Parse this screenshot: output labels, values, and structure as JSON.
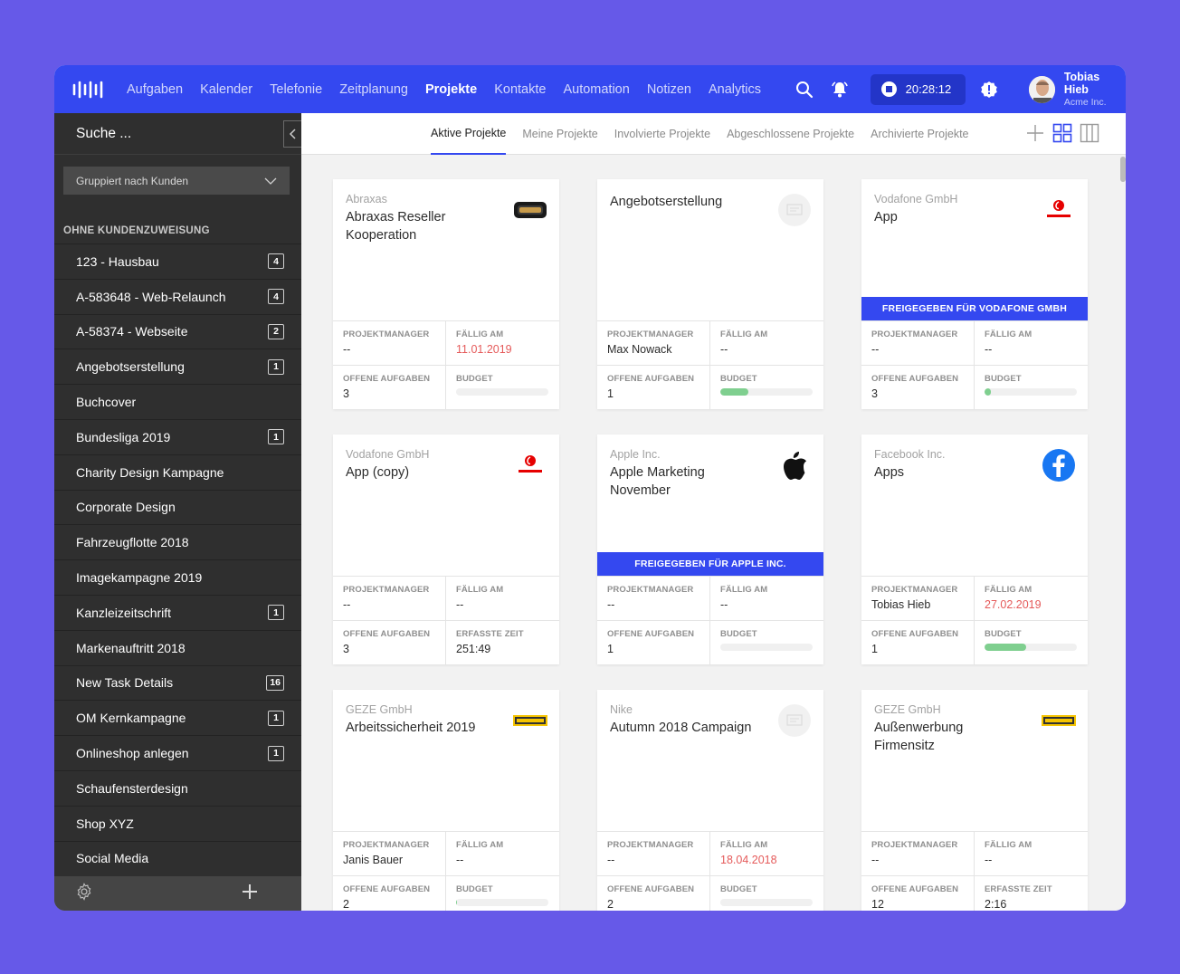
{
  "nav": {
    "items": [
      "Aufgaben",
      "Kalender",
      "Telefonie",
      "Zeitplanung",
      "Projekte",
      "Kontakte",
      "Automation",
      "Notizen",
      "Analytics"
    ],
    "active_index": 4
  },
  "timer": {
    "time": "20:28:12"
  },
  "user": {
    "name": "Tobias Hieb",
    "org": "Acme Inc."
  },
  "sidebar": {
    "search_placeholder": "Suche ...",
    "group_label": "Gruppiert nach Kunden",
    "section_title": "OHNE KUNDENZUWEISUNG",
    "items": [
      {
        "label": "123 - Hausbau",
        "count": "4"
      },
      {
        "label": "A-583648 - Web-Relaunch",
        "count": "4"
      },
      {
        "label": "A-58374 - Webseite",
        "count": "2"
      },
      {
        "label": "Angebotserstellung",
        "count": "1"
      },
      {
        "label": "Buchcover",
        "count": ""
      },
      {
        "label": "Bundesliga 2019",
        "count": "1"
      },
      {
        "label": "Charity Design Kampagne",
        "count": ""
      },
      {
        "label": "Corporate Design",
        "count": ""
      },
      {
        "label": "Fahrzeugflotte 2018",
        "count": ""
      },
      {
        "label": "Imagekampagne 2019",
        "count": ""
      },
      {
        "label": "Kanzleizeitschrift",
        "count": "1"
      },
      {
        "label": "Markenauftritt 2018",
        "count": ""
      },
      {
        "label": "New Task Details",
        "count": "16"
      },
      {
        "label": "OM Kernkampagne",
        "count": "1"
      },
      {
        "label": "Onlineshop anlegen",
        "count": "1"
      },
      {
        "label": "Schaufensterdesign",
        "count": ""
      },
      {
        "label": "Shop XYZ",
        "count": ""
      },
      {
        "label": "Social Media",
        "count": ""
      }
    ]
  },
  "tabs": [
    "Aktive Projekte",
    "Meine Projekte",
    "Involvierte Projekte",
    "Abgeschlossene Projekte",
    "Archivierte Projekte"
  ],
  "labels": {
    "manager": "PROJEKTMANAGER",
    "due": "FÄLLIG AM",
    "open_tasks": "OFFENE AUFGABEN",
    "budget": "BUDGET",
    "tracked": "ERFASSTE ZEIT"
  },
  "colors": {
    "brand": "#3448F0",
    "overdue": "#e55a5a",
    "budget": "#7fcf8f"
  },
  "cards": [
    {
      "client": "Abraxas",
      "name": "Abraxas Reseller Kooperation",
      "logo": "abraxas-logo-icon",
      "shared": "",
      "manager": "--",
      "due": "11.01.2019",
      "due_overdue": true,
      "tasks": "3",
      "metric": "budget",
      "budget_fraction": 0,
      "tracked": ""
    },
    {
      "client": "",
      "name": "Angebotserstellung",
      "logo": "placeholder-logo-icon",
      "shared": "",
      "manager": "Max Nowack",
      "due": "--",
      "due_overdue": false,
      "tasks": "1",
      "metric": "budget",
      "budget_fraction": 0.3,
      "tracked": ""
    },
    {
      "client": "Vodafone GmbH",
      "name": "App",
      "logo": "vodafone-logo-icon",
      "shared": "FREIGEGEBEN FÜR VODAFONE GMBH",
      "manager": "--",
      "due": "--",
      "due_overdue": false,
      "tasks": "3",
      "metric": "budget",
      "budget_fraction": 0.07,
      "tracked": ""
    },
    {
      "client": "Vodafone GmbH",
      "name": "App (copy)",
      "logo": "vodafone-logo-icon",
      "shared": "",
      "manager": "--",
      "due": "--",
      "due_overdue": false,
      "tasks": "3",
      "metric": "tracked",
      "budget_fraction": 0,
      "tracked": "251:49"
    },
    {
      "client": "Apple Inc.",
      "name": "Apple Marketing November",
      "logo": "apple-logo-icon",
      "shared": "FREIGEGEBEN FÜR APPLE INC.",
      "manager": "--",
      "due": "--",
      "due_overdue": false,
      "tasks": "1",
      "metric": "budget",
      "budget_fraction": 0,
      "tracked": ""
    },
    {
      "client": "Facebook Inc.",
      "name": "Apps",
      "logo": "facebook-logo-icon",
      "shared": "",
      "manager": "Tobias Hieb",
      "due": "27.02.2019",
      "due_overdue": true,
      "tasks": "1",
      "metric": "budget",
      "budget_fraction": 0.45,
      "tracked": ""
    },
    {
      "client": "GEZE GmbH",
      "name": "Arbeitssicherheit 2019",
      "logo": "geze-logo-icon",
      "shared": "",
      "manager": "Janis Bauer",
      "due": "--",
      "due_overdue": false,
      "tasks": "2",
      "metric": "budget",
      "budget_fraction": 0.01,
      "tracked": ""
    },
    {
      "client": "Nike",
      "name": "Autumn 2018 Campaign",
      "logo": "placeholder-logo-icon",
      "shared": "",
      "manager": "--",
      "due": "18.04.2018",
      "due_overdue": true,
      "tasks": "2",
      "metric": "budget",
      "budget_fraction": 0,
      "tracked": ""
    },
    {
      "client": "GEZE GmbH",
      "name": "Außenwerbung Firmensitz",
      "logo": "geze-logo-icon",
      "shared": "",
      "manager": "--",
      "due": "--",
      "due_overdue": false,
      "tasks": "12",
      "metric": "tracked",
      "budget_fraction": 0,
      "tracked": "2:16"
    }
  ]
}
